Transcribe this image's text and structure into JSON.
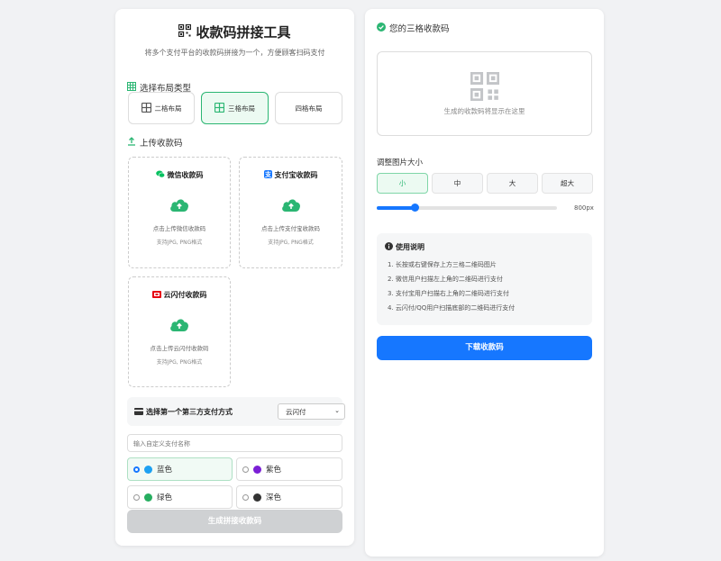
{
  "header": {
    "title": "收款码拼接工具",
    "subtitle": "将多个支付平台的收款码拼接为一个，方便顾客扫码支付"
  },
  "layout": {
    "section_title": "选择布局类型",
    "options": [
      {
        "label": "二格布局",
        "selected": false
      },
      {
        "label": "三格布局",
        "selected": true
      },
      {
        "label": "四格布局",
        "selected": false
      }
    ]
  },
  "upload": {
    "section_title": "上传收款码",
    "boxes": [
      {
        "title": "微信收款码",
        "hint": "点击上传微信收款码",
        "formats": "支持JPG, PNG格式"
      },
      {
        "title": "支付宝收款码",
        "hint": "点击上传支付宝收款码",
        "formats": "支持JPG, PNG格式"
      },
      {
        "title": "云闪付收款码",
        "hint": "点击上传云闪付收款码",
        "formats": "支持JPG, PNG格式"
      }
    ]
  },
  "third_party": {
    "label": "选择第一个第三方支付方式",
    "selected": "云闪付"
  },
  "custom_name": {
    "placeholder": "输入自定义支付名称"
  },
  "colors": {
    "options": [
      {
        "label": "蓝色",
        "swatch": "#1da1f2",
        "selected": true
      },
      {
        "label": "紫色",
        "swatch": "#7b1fd6",
        "selected": false
      },
      {
        "label": "绿色",
        "swatch": "#27ae60",
        "selected": false
      },
      {
        "label": "深色",
        "swatch": "#333333",
        "selected": false
      }
    ]
  },
  "generate_button": "生成拼接收款码",
  "result": {
    "header": "您的三格收款码",
    "placeholder": "生成的收款码将显示在这里"
  },
  "size": {
    "label": "调整图片大小",
    "options": [
      {
        "label": "小",
        "selected": true
      },
      {
        "label": "中",
        "selected": false
      },
      {
        "label": "大",
        "selected": false
      },
      {
        "label": "超大",
        "selected": false
      }
    ],
    "slider_fraction": 0.21,
    "value": "800px"
  },
  "instructions": {
    "title": "使用说明",
    "items": [
      "1. 长按或右键保存上方三格二维码图片",
      "2. 微信用户扫描左上角的二维码进行支付",
      "3. 支付宝用户扫描右上角的二维码进行支付",
      "4. 云闪付/QQ用户扫描底部的二维码进行支付"
    ]
  },
  "download_button": "下载收款码",
  "theme": {
    "green": "#2bb673",
    "blue": "#1677ff",
    "wechat": "#07c160",
    "alipay": "#1677ff",
    "unionpay": "#e60012"
  }
}
